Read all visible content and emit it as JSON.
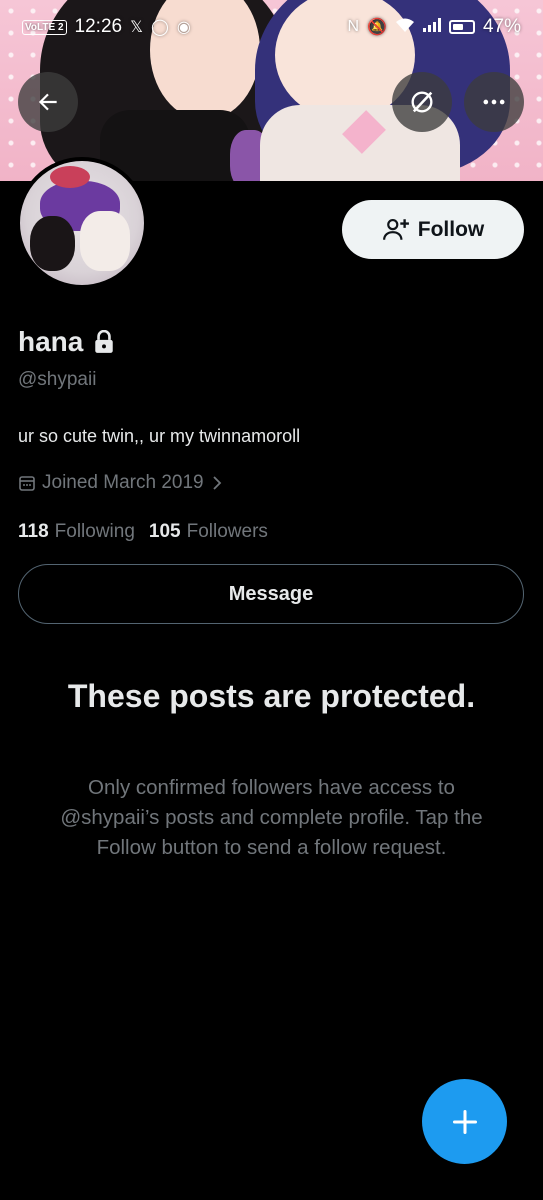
{
  "status_bar": {
    "time": "12:26",
    "volte": "VoLTE 2",
    "battery": "47%"
  },
  "profile": {
    "display_name": "hana",
    "handle": "@shypaii",
    "bio": "ur so cute twin,, ur my twinnamoroll",
    "joined": "Joined March 2019",
    "following_count": "118",
    "following_label": "Following",
    "followers_count": "105",
    "followers_label": "Followers",
    "locked": true
  },
  "actions": {
    "follow_label": "Follow",
    "message_label": "Message"
  },
  "protected": {
    "title": "These posts are protected.",
    "body": "Only confirmed followers have access to @shypaii’s posts and complete profile. Tap the Follow button to send a follow request."
  },
  "icons": {
    "back": "arrow-left-icon",
    "grok": "grok-icon",
    "more": "more-horizontal-icon",
    "follow": "person-add-icon",
    "lock": "lock-icon",
    "calendar": "calendar-icon",
    "chevron": "chevron-right-icon",
    "compose": "plus-icon"
  },
  "colors": {
    "accent": "#1d9bf0",
    "background": "#000000",
    "primary_text": "#e7e9ea",
    "secondary_text": "#71767b"
  }
}
